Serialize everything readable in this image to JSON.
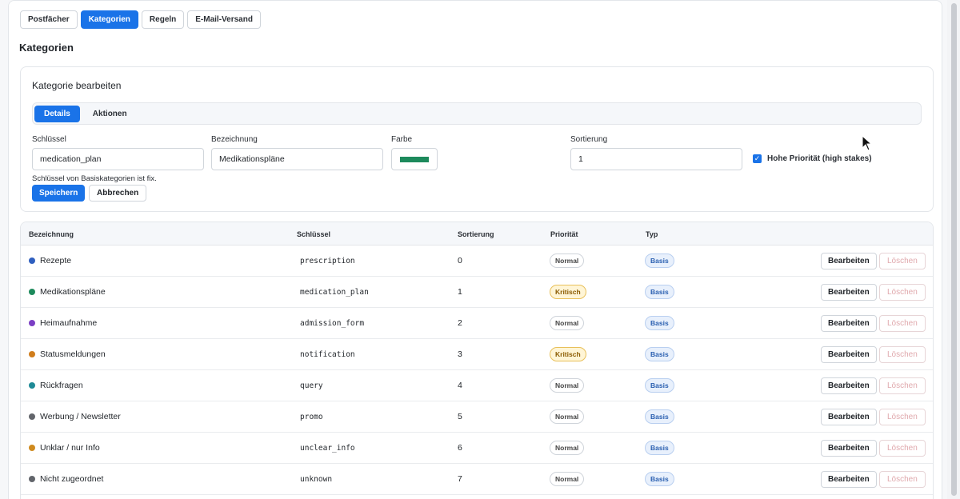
{
  "top_tabs": [
    {
      "label": "Postfächer"
    },
    {
      "label": "Kategorien"
    },
    {
      "label": "Regeln"
    },
    {
      "label": "E-Mail-Versand"
    }
  ],
  "section_title": "Kategorien",
  "edit": {
    "title": "Kategorie bearbeiten",
    "tabs": [
      {
        "label": "Details"
      },
      {
        "label": "Aktionen"
      }
    ],
    "fields": {
      "key_label": "Schlüssel",
      "key_value": "medication_plan",
      "name_label": "Bezeichnung",
      "name_value": "Medikationspläne",
      "color_label": "Farbe",
      "color_value": "#1d8a5c",
      "sort_label": "Sortierung",
      "sort_value": "1",
      "priority_label": "Hohe Priorität (high stakes)",
      "priority_checked": true
    },
    "hint": "Schlüssel von Basiskategorien ist fix.",
    "save_label": "Speichern",
    "cancel_label": "Abbrechen"
  },
  "table": {
    "headers": {
      "name": "Bezeichnung",
      "key": "Schlüssel",
      "sort": "Sortierung",
      "priority": "Priorität",
      "type": "Typ"
    },
    "edit_label": "Bearbeiten",
    "delete_label": "Löschen",
    "rows": [
      {
        "name": "Rezepte",
        "key": "prescription",
        "sort": "0",
        "priority": "Normal",
        "type": "Basis",
        "color": "#2f5fbf"
      },
      {
        "name": "Medikationspläne",
        "key": "medication_plan",
        "sort": "1",
        "priority": "Kritisch",
        "type": "Basis",
        "color": "#1d8a5c"
      },
      {
        "name": "Heimaufnahme",
        "key": "admission_form",
        "sort": "2",
        "priority": "Normal",
        "type": "Basis",
        "color": "#7b3fc4"
      },
      {
        "name": "Statusmeldungen",
        "key": "notification",
        "sort": "3",
        "priority": "Kritisch",
        "type": "Basis",
        "color": "#d07d1c"
      },
      {
        "name": "Rückfragen",
        "key": "query",
        "sort": "4",
        "priority": "Normal",
        "type": "Basis",
        "color": "#1f8a96"
      },
      {
        "name": "Werbung / Newsletter",
        "key": "promo",
        "sort": "5",
        "priority": "Normal",
        "type": "Basis",
        "color": "#62656b"
      },
      {
        "name": "Unklar / nur Info",
        "key": "unclear_info",
        "sort": "6",
        "priority": "Normal",
        "type": "Basis",
        "color": "#cf8a1e"
      },
      {
        "name": "Nicht zugeordnet",
        "key": "unknown",
        "sort": "7",
        "priority": "Normal",
        "type": "Basis",
        "color": "#62656b"
      }
    ]
  }
}
